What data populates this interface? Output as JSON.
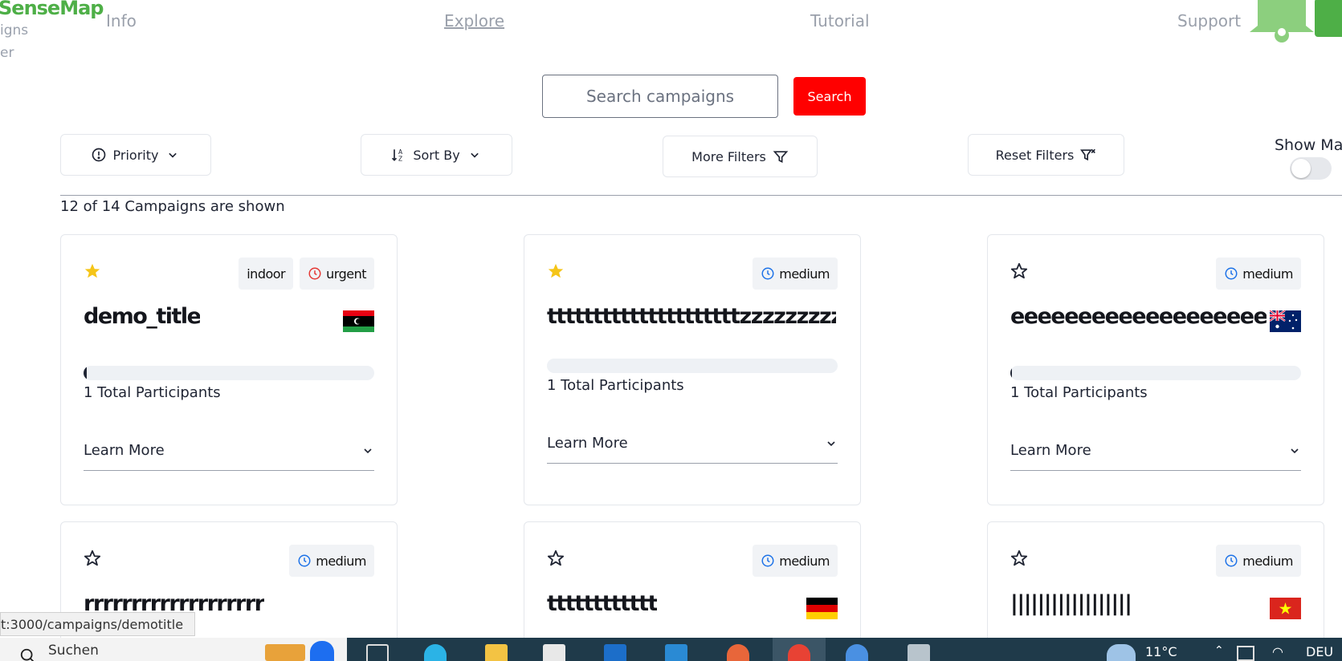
{
  "header": {
    "logo": "SenseMap",
    "logo_sub1": "igns",
    "logo_sub2": "er",
    "nav": [
      {
        "label": "Info",
        "active": false
      },
      {
        "label": "Explore",
        "active": true
      },
      {
        "label": "Tutorial",
        "active": false
      },
      {
        "label": "Support",
        "active": false
      }
    ],
    "bell_icon": "bell-icon"
  },
  "search": {
    "placeholder": "Search campaigns",
    "button_label": "Search"
  },
  "filters": {
    "priority_label": "Priority",
    "sortby_label": "Sort By",
    "more_filters_label": "More Filters",
    "reset_filters_label": "Reset Filters",
    "show_map_label": "Show Map",
    "show_map_on": false
  },
  "count_text": "12 of 14 Campaigns are shown",
  "cards": [
    {
      "starred": true,
      "badges": [
        {
          "text": "indoor",
          "icon": null
        },
        {
          "text": "urgent",
          "icon": "clock-icon",
          "color": "#e53935"
        }
      ],
      "title": "demo_title",
      "flag": "libya",
      "progress": 0.01,
      "participants": "1 Total Participants",
      "learn_more": "Learn More"
    },
    {
      "starred": true,
      "badges": [
        {
          "text": "medium",
          "icon": "clock-icon",
          "color": "#1e73e8"
        }
      ],
      "title": "tttttttttttttttttttttzzzzzzzzzzz",
      "flag": null,
      "progress": 0,
      "participants": "1 Total Participants",
      "learn_more": "Learn More"
    },
    {
      "starred": false,
      "badges": [
        {
          "text": "medium",
          "icon": "clock-icon",
          "color": "#1e73e8"
        }
      ],
      "title": "eeeeeeeeeeeeeeeeeee",
      "flag": "australia",
      "progress": 0.005,
      "participants": "1 Total Participants",
      "learn_more": "Learn More"
    },
    {
      "starred": false,
      "badges": [
        {
          "text": "medium",
          "icon": "clock-icon",
          "color": "#1e73e8"
        }
      ],
      "title": "rrrrrrrrrrrrrrrrrrr",
      "flag": null
    },
    {
      "starred": false,
      "badges": [
        {
          "text": "medium",
          "icon": "clock-icon",
          "color": "#1e73e8"
        }
      ],
      "title": "tttttttttttt",
      "flag": "germany"
    },
    {
      "starred": false,
      "badges": [
        {
          "text": "medium",
          "icon": "clock-icon",
          "color": "#1e73e8"
        }
      ],
      "title": "||||||||||||||||||",
      "flag": "vietnam"
    }
  ],
  "status_url": "t:3000/campaigns/demotitle",
  "taskbar": {
    "search_text": "Suchen",
    "weather": "11°C",
    "lang": "DEU"
  },
  "colors": {
    "brand_green": "#4eaf47",
    "search_red": "#ff0000",
    "star_yellow": "#f5c518",
    "urgent_red": "#e53935",
    "medium_blue": "#1e73e8"
  }
}
